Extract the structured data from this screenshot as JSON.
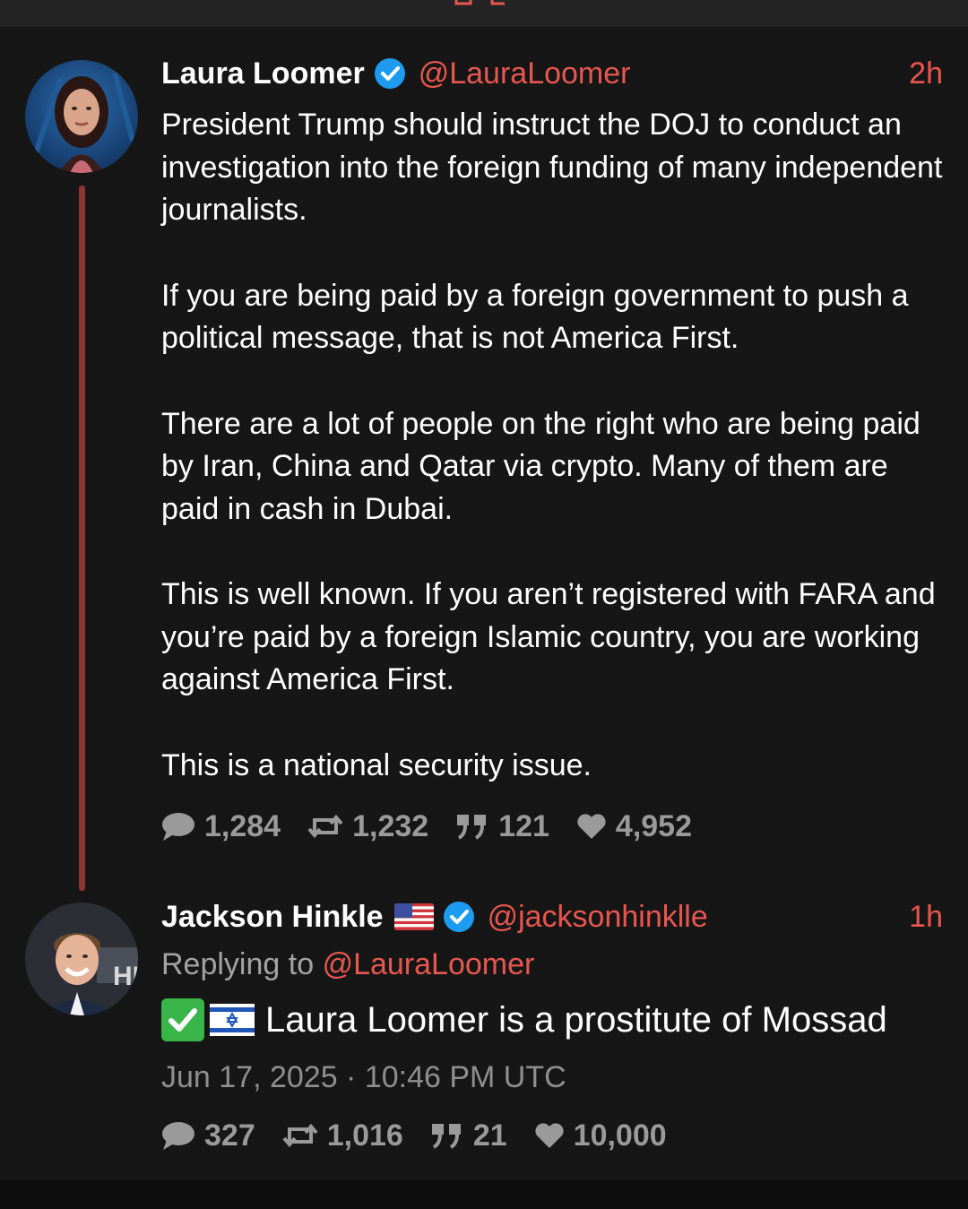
{
  "thread": {
    "tweet1": {
      "author_name": "Laura Loomer",
      "handle": "@LauraLoomer",
      "time": "2h",
      "paragraphs": [
        "President Trump should instruct the DOJ to conduct an investigation into the foreign funding of many independent journalists.",
        "If you are being paid by a foreign government to push a political message, that is not America First.",
        "There are a lot of people on the right who are being paid by Iran, China and Qatar via crypto. Many of them are paid in cash in Dubai.",
        "This is well known. If you aren’t registered with FARA and you’re paid by a foreign Islamic country, you are working against America First.",
        "This is a national security issue."
      ],
      "stats": {
        "replies": "1,284",
        "retweets": "1,232",
        "quotes": "121",
        "likes": "4,952"
      }
    },
    "tweet2": {
      "author_name": "Jackson Hinkle",
      "handle": "@jacksonhinklle",
      "time": "1h",
      "replying_prefix": "Replying to",
      "replying_handle": "@LauraLoomer",
      "text": "Laura Loomer is a prostitute of Mossad",
      "datetime": "Jun 17, 2025 · 10:46 PM UTC",
      "stats": {
        "replies": "327",
        "retweets": "1,016",
        "quotes": "21",
        "likes": "10,000"
      }
    }
  },
  "icons": {
    "verified": "verified-badge-icon",
    "reply": "comment-bubble-icon",
    "retweet": "retweet-icon",
    "quote": "quote-icon",
    "like": "heart-icon",
    "check_emoji": "check-mark-emoji",
    "israel_flag": "israel-flag-emoji",
    "us_flag": "us-flag-emoji"
  },
  "colors": {
    "background": "#161616",
    "accent": "#e8574f",
    "verified": "#1d9bf0",
    "thread_line": "#8a3434",
    "stat_gray": "#9a9a9a"
  }
}
